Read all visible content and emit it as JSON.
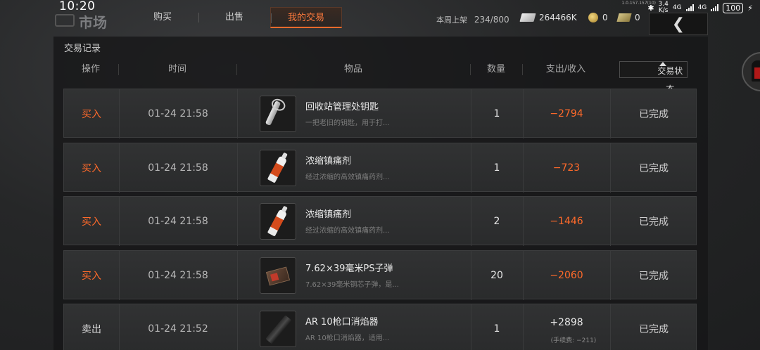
{
  "status_bar": {
    "time": "10:20",
    "version": "1.0.157.157(10)",
    "speed_value": "3.4",
    "speed_unit": "K/s",
    "net1": "4G",
    "net2": "4G",
    "battery": "100"
  },
  "header": {
    "title": "市场",
    "tabs": [
      {
        "label": "购买",
        "active": false
      },
      {
        "label": "出售",
        "active": false
      },
      {
        "label": "我的交易",
        "active": true
      }
    ],
    "weekly_label": "本周上架",
    "weekly_value": "234/800",
    "currencies": [
      {
        "icon": "cash-icon",
        "value": "264466K"
      },
      {
        "icon": "gold-coin-icon",
        "value": "0"
      },
      {
        "icon": "voucher-icon",
        "value": "0"
      }
    ],
    "back_icon": "chevron-left-icon"
  },
  "panel": {
    "title": "交易记录",
    "columns": {
      "action": "操作",
      "time": "时间",
      "item": "物品",
      "quantity": "数量",
      "amount": "支出/收入",
      "status": "交易状态"
    }
  },
  "rows": [
    {
      "action": "买入",
      "type": "buy",
      "time": "01-24 21:58",
      "name": "回收站管理处钥匙",
      "desc": "一把老旧的钥匙，用于打...",
      "qty": "1",
      "amount": "−2794",
      "fee": "",
      "status": "已完成",
      "art": "key"
    },
    {
      "action": "买入",
      "type": "buy",
      "time": "01-24 21:58",
      "name": "浓缩镇痛剂",
      "desc": "经过浓缩的高效镇痛药剂...",
      "qty": "1",
      "amount": "−723",
      "fee": "",
      "status": "已完成",
      "art": "spray"
    },
    {
      "action": "买入",
      "type": "buy",
      "time": "01-24 21:58",
      "name": "浓缩镇痛剂",
      "desc": "经过浓缩的高效镇痛药剂...",
      "qty": "2",
      "amount": "−1446",
      "fee": "",
      "status": "已完成",
      "art": "spray"
    },
    {
      "action": "买入",
      "type": "buy",
      "time": "01-24 21:58",
      "name": "7.62×39毫米PS子弹",
      "desc": "7.62×39毫米钢芯子弹，是...",
      "qty": "20",
      "amount": "−2060",
      "fee": "",
      "status": "已完成",
      "art": "ammo"
    },
    {
      "action": "卖出",
      "type": "sell",
      "time": "01-24 21:52",
      "name": "AR 10枪口消焰器",
      "desc": "AR 10枪口消焰器，适用...",
      "qty": "1",
      "amount": "+2898",
      "fee": "(手续费: −211)",
      "status": "已完成",
      "art": "suppressor"
    }
  ]
}
